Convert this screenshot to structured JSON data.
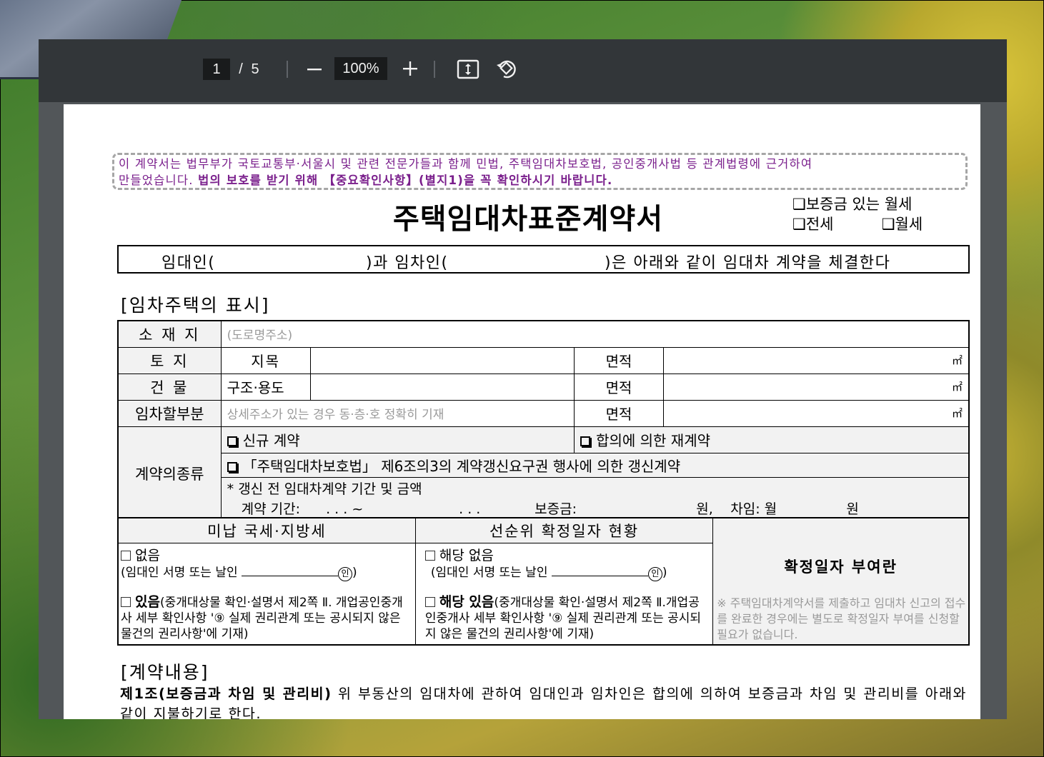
{
  "toolbar": {
    "current_page": "1",
    "page_separator": "/",
    "total_pages": "5",
    "zoom_out_label": "−",
    "zoom_level": "100%",
    "zoom_in_label": "+"
  },
  "document": {
    "notice_line1": "이 계약서는 법무부가 국토교통부·서울시 및 관련 전문가들과 함께 민법, 주택임대차보호법, 공인중개사법 등 관계법령에 근거하여",
    "notice_line2_plain": "만들었습니다. ",
    "notice_line2_bold": "법의 보호를 받기 위해 【중요확인사항】(별지1)을 꼭 확인하시기 바랍니다.",
    "title": "주택임대차표준계약서",
    "type_options": [
      "❑보증금 있는 월세",
      "❑전세",
      "❑월세"
    ],
    "parties": {
      "lessor": "임대인(",
      "middle": ")과 임차인(",
      "end": ")은 아래와 같이 임대차 계약을 체결한다"
    },
    "section_property": "[임차주택의 표시]",
    "property_table": {
      "location_label": "소 재 지",
      "location_placeholder": "(도로명주소)",
      "land_label": "토 지",
      "land_type_label": "지목",
      "area_label": "면적",
      "unit": "㎡",
      "building_label": "건 물",
      "building_struct_label": "구조·용도",
      "leased_part_label": "임차할부분",
      "leased_part_placeholder": "상세주소가 있는 경우 동·층·호 정확히 기재",
      "contract_kind_label": "계약의종류",
      "kind_new": "신규 계약",
      "kind_renew_agree": "합의에 의한 재계약",
      "kind_renew_right": "「주택임대차보호법」 제6조의3의 계약갱신요구권 행사에 의한 갱신계약",
      "kind_prev_title": "* 갱신 전 임대차계약 기간 및 금액",
      "kind_prev_period": "계약 기간:",
      "kind_prev_dots1": ".   .   . ~",
      "kind_prev_dots2": ".   .   .",
      "kind_prev_deposit": "보증금:",
      "kind_prev_won1": "원,",
      "kind_prev_rent": "차임: 월",
      "kind_prev_won2": "원"
    },
    "lower_table": {
      "tax_header": "미납 국세·지방세",
      "priority_header": "선순위 확정일자 현황",
      "tax_none": "없음",
      "tax_sign": "(임대인 서명 또는 날인",
      "seal": "인",
      "tax_exist_bold": "있음",
      "tax_exist_rest": "(중개대상물 확인·설명서 제2쪽 Ⅱ. 개업공인중개사 세부 확인사항 '⑨ 실제 권리관계 또는 공시되지 않은 물건의 권리사항'에 기재)",
      "prio_none": "해당 없음",
      "prio_sign": "(임대인 서명 또는 날인",
      "prio_exist_bold": "해당 있음",
      "prio_exist_rest": "(중개대상물 확인·설명서 제2쪽 Ⅱ.개업공인중개사 세부 확인사항 '⑨ 실제 권리관계 또는 공시되지 않은 물건의 권리사항'에 기재)",
      "confirm_title": "확정일자 부여란",
      "confirm_note": "※ 주택임대차계약서를 제출하고 임대차 신고의 접수를 완료한 경우에는 별도로 확정일자 부여를 신청할 필요가 없습니다."
    },
    "section_contract": "[계약내용]",
    "article1_bold": "제1조(보증금과 차임 및 관리비)",
    "article1_text": " 위 부동산의 임대차에 관하여 임대인과 임차인은 합의에 의하여 보증금과 차임 및 관리비를 아래와 같이 지불하기로 한다."
  },
  "colors": {
    "toolbar_bg": "#323639",
    "viewer_bg": "#525659",
    "notice_text": "#7a1f8c"
  },
  "icons": [
    "zoom-out-icon",
    "zoom-in-icon",
    "fit-to-page-icon",
    "rotate-icon"
  ]
}
